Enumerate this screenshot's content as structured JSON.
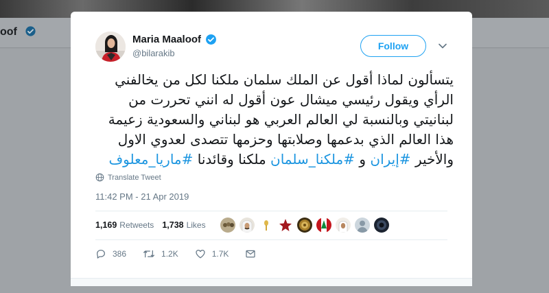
{
  "background": {
    "profile_name_partial": "oof"
  },
  "tweet": {
    "author_name": "Maria Maaloof",
    "handle": "@bilarakib",
    "follow_label": "Follow",
    "text_lines": [
      "يتسألون لماذا أقول عن الملك سلمان ملكنا لكل من يخالفني",
      "الرأي ويقول رئيسي ميشال عون أقول له انني تحررت من",
      "لبنانيتي وبالنسبة لي العالم العربي هو لبناني والسعودية زعيمة",
      "هذا العالم الذي بدعمها وصلابتها وحزمها تتصدى لعدوي الاول"
    ],
    "last_line_start": "والأخير",
    "hashtag_iran": "#إيران",
    "and_word": "و",
    "hashtag_salman": "#ملكنا_سلمان",
    "last_line_middle": "ملكنا وقائدنا",
    "hashtag_maria": "#ماريا_معلوف",
    "translate_label": "Translate Tweet",
    "timestamp": "11:42 PM - 21 Apr 2019",
    "retweets_count": "1,169",
    "retweets_label": "Retweets",
    "likes_count": "1,738",
    "likes_label": "Likes",
    "replies": "386",
    "retweets_short": "1.2K",
    "likes_short": "1.7K"
  },
  "colors": {
    "accent": "#1da1f2",
    "hashtag": "#1b95e0",
    "muted": "#657786",
    "overlay": "#9fa3a7"
  }
}
